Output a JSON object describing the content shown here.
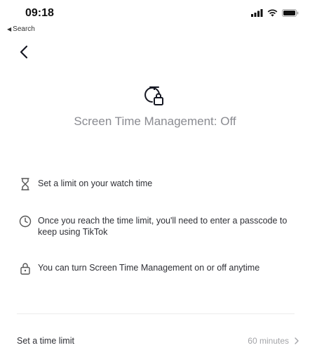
{
  "status_bar": {
    "time": "09:18",
    "back_to_app": "Search",
    "icons": [
      "signal-icon",
      "wifi-icon",
      "battery-icon"
    ]
  },
  "page": {
    "title": "Screen Time Management: Off",
    "hero_icon": "timer-lock-icon"
  },
  "features": [
    {
      "icon": "hourglass-icon",
      "text": "Set a limit on your watch time"
    },
    {
      "icon": "clock-icon",
      "text": "Once you reach the time limit, you'll need to enter a passcode to keep using TikTok"
    },
    {
      "icon": "lock-icon",
      "text": "You can turn Screen Time Management on or off anytime"
    }
  ],
  "settings": {
    "time_limit_label": "Set a time limit",
    "time_limit_value": "60 minutes"
  },
  "colors": {
    "title": "#8a8b91",
    "text": "#2f3036",
    "muted": "#a3a4a8"
  }
}
